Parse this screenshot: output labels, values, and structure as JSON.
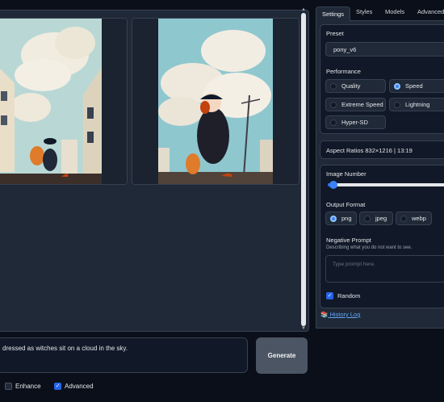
{
  "tabs": [
    {
      "label": "Settings",
      "active": true
    },
    {
      "label": "Styles",
      "active": false
    },
    {
      "label": "Models",
      "active": false
    },
    {
      "label": "Advanced",
      "active": false
    }
  ],
  "preset": {
    "label": "Preset",
    "value": "pony_v6"
  },
  "performance": {
    "label": "Performance",
    "options": [
      "Quality",
      "Speed",
      "Extreme Speed",
      "Lightning",
      "Hyper-SD"
    ],
    "selected": "Speed"
  },
  "aspect_ratios": {
    "label": "Aspect Ratios 832×1216 | 13:19"
  },
  "image_number": {
    "label": "Image Number",
    "value_fraction": 0.01
  },
  "output_format": {
    "label": "Output Format",
    "options": [
      "png",
      "jpeg",
      "webp"
    ],
    "selected": "png"
  },
  "negative_prompt": {
    "label": "Negative Prompt",
    "description": "Describing what you do not want to see.",
    "placeholder": "Type prompt here."
  },
  "random": {
    "label": "Random",
    "checked": true
  },
  "history_log": {
    "label": "History Log"
  },
  "prompt": {
    "text": "dressed as witches sit on a cloud in the sky."
  },
  "generate": {
    "label": "Generate"
  },
  "enhance": {
    "label": "Enhance",
    "checked": false
  },
  "advanced": {
    "label": "Advanced",
    "checked": true
  },
  "colors": {
    "accent": "#2563eb",
    "background": "#0b0f19",
    "panel": "#1f2937"
  }
}
